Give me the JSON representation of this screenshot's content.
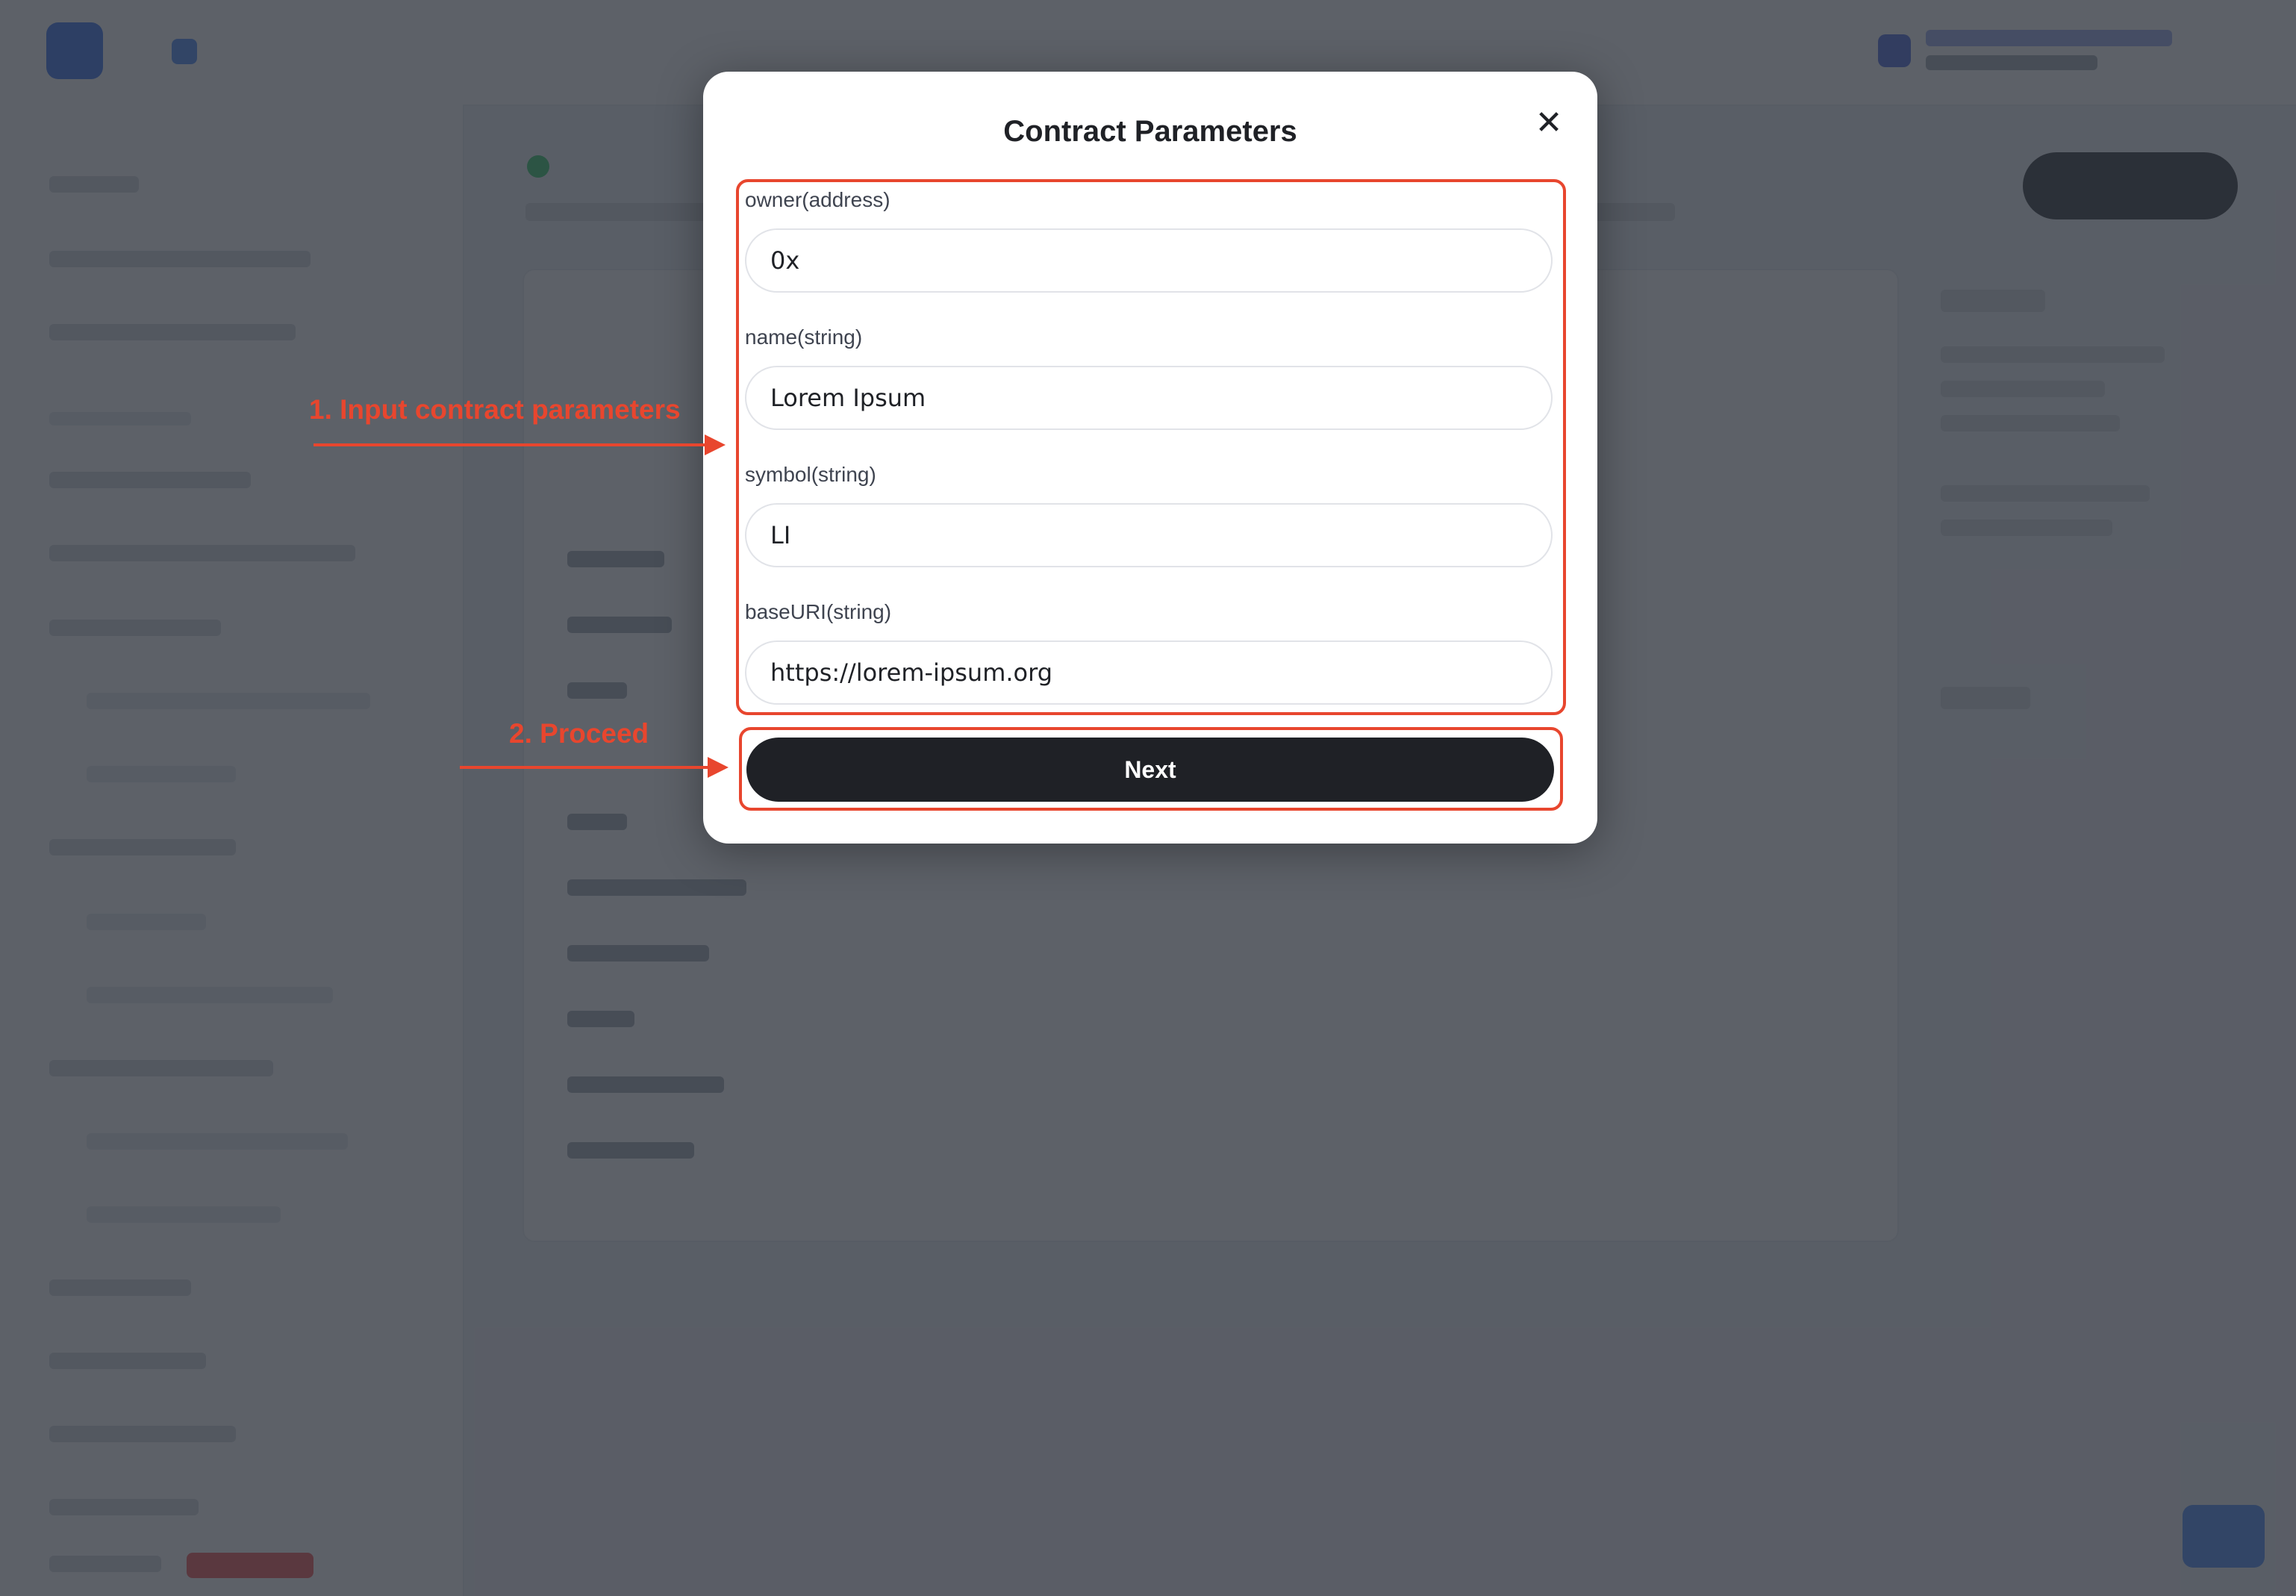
{
  "modal": {
    "title": "Contract Parameters",
    "close_icon": "close-icon",
    "fields": [
      {
        "label": "owner(address)",
        "value": "0x"
      },
      {
        "label": "name(string)",
        "value": "Lorem Ipsum"
      },
      {
        "label": "symbol(string)",
        "value": "LI"
      },
      {
        "label": "baseURI(string)",
        "value": "https://lorem-ipsum.org"
      }
    ],
    "next_label": "Next"
  },
  "annotations": {
    "step1": "1. Input contract parameters",
    "step2": "2. Proceed"
  },
  "colors": {
    "annotation": "#e8462e",
    "primary_button": "#1f2126",
    "overlay": "#30343e"
  }
}
